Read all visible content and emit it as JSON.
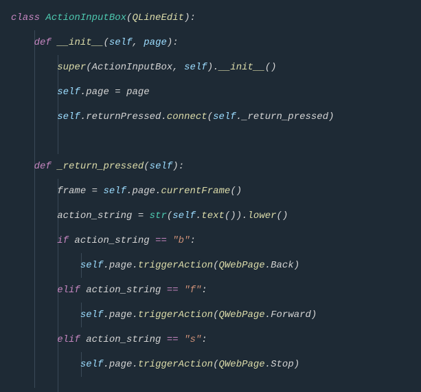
{
  "code": {
    "line1": {
      "class_kw": "class",
      "class_name": "ActionInputBox",
      "lparen": "(",
      "base": "QLineEdit",
      "rparen": ")",
      "colon": ":"
    },
    "line2": {
      "def_kw": "def",
      "method": "__init__",
      "lparen": "(",
      "self": "self",
      "comma": ", ",
      "param": "page",
      "rparen": ")",
      "colon": ":"
    },
    "line3": {
      "super": "super",
      "lparen": "(",
      "cls": "ActionInputBox",
      "comma": ", ",
      "self": "self",
      "rparen": ")",
      "dot": ".",
      "init": "__init__",
      "call": "()"
    },
    "line4": {
      "self": "self",
      "dot": ".",
      "attr": "page",
      "eq": " = ",
      "val": "page"
    },
    "line5": {
      "self": "self",
      "dot1": ".",
      "attr1": "returnPressed",
      "dot2": ".",
      "connect": "connect",
      "lparen": "(",
      "self2": "self",
      "dot3": ".",
      "method": "_return_pressed",
      "rparen": ")"
    },
    "line6": {
      "def_kw": "def",
      "method": "_return_pressed",
      "lparen": "(",
      "self": "self",
      "rparen": ")",
      "colon": ":"
    },
    "line7": {
      "var": "frame",
      "eq": " = ",
      "self": "self",
      "dot1": ".",
      "attr": "page",
      "dot2": ".",
      "call": "currentFrame",
      "parens": "()"
    },
    "line8": {
      "var": "action_string",
      "eq": " = ",
      "str_fn": "str",
      "lparen": "(",
      "self": "self",
      "dot1": ".",
      "text": "text",
      "call1": "()",
      "rparen": ")",
      "dot2": ".",
      "lower": "lower",
      "call2": "()"
    },
    "line9": {
      "if_kw": "if",
      "var": " action_string ",
      "eq": "==",
      "str": " \"b\"",
      "colon": ":"
    },
    "line10": {
      "self": "self",
      "dot1": ".",
      "attr": "page",
      "dot2": ".",
      "trigger": "triggerAction",
      "lparen": "(",
      "qweb": "QWebPage",
      "dot3": ".",
      "action": "Back",
      "rparen": ")"
    },
    "line11": {
      "elif_kw": "elif",
      "var": " action_string ",
      "eq": "==",
      "str": " \"f\"",
      "colon": ":"
    },
    "line12": {
      "self": "self",
      "dot1": ".",
      "attr": "page",
      "dot2": ".",
      "trigger": "triggerAction",
      "lparen": "(",
      "qweb": "QWebPage",
      "dot3": ".",
      "action": "Forward",
      "rparen": ")"
    },
    "line13": {
      "elif_kw": "elif",
      "var": " action_string ",
      "eq": "==",
      "str": " \"s\"",
      "colon": ":"
    },
    "line14": {
      "self": "self",
      "dot1": ".",
      "attr": "page",
      "dot2": ".",
      "trigger": "triggerAction",
      "lparen": "(",
      "qweb": "QWebPage",
      "dot3": ".",
      "action": "Stop",
      "rparen": ")"
    }
  }
}
